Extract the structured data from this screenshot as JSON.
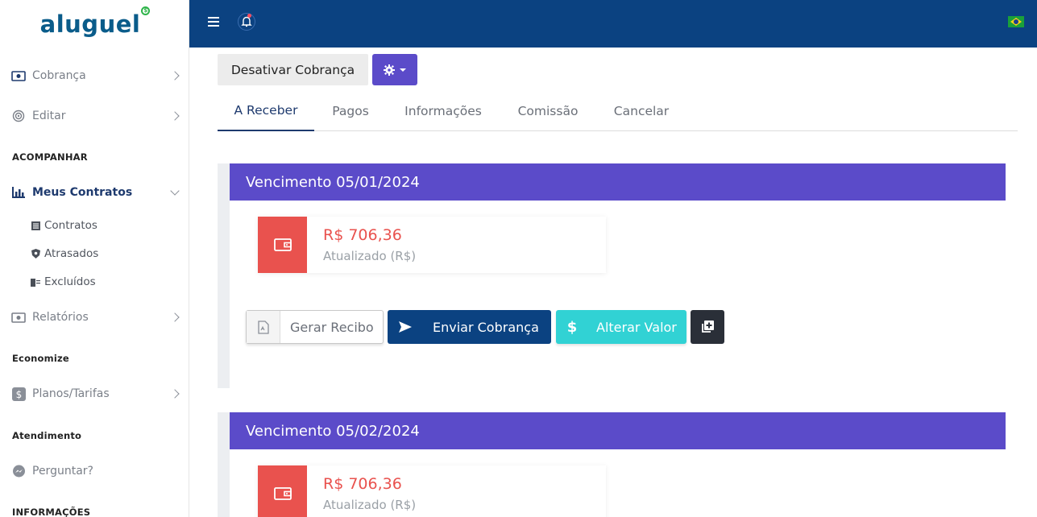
{
  "brand": {
    "name": "aluguel"
  },
  "sidebar": {
    "items": [
      {
        "label": "Cobrança",
        "icon": "money-icon"
      },
      {
        "label": "Editar",
        "icon": "target-icon"
      },
      {
        "label": "Meus Contratos",
        "icon": "bar-chart-icon"
      },
      {
        "label": "Relatórios",
        "icon": "money-icon"
      },
      {
        "label": "Planos/Tarifas",
        "icon": "dollar-icon"
      },
      {
        "label": "Perguntar?",
        "icon": "messenger-icon"
      }
    ],
    "sections": [
      "ACOMPANHAR",
      "Economize",
      "Atendimento",
      "INFORMAÇÕES"
    ],
    "subitems": [
      {
        "label": "Contratos",
        "icon": "list-icon"
      },
      {
        "label": "Atrasados",
        "icon": "shield-icon"
      },
      {
        "label": "Excluídos",
        "icon": "trash-icon"
      }
    ]
  },
  "topbar": {
    "notification_dot_color": "#ff4d5e"
  },
  "toolbar": {
    "deactivate_label": "Desativar Cobrança"
  },
  "tabs": [
    {
      "label": "A Receber",
      "active": true
    },
    {
      "label": "Pagos"
    },
    {
      "label": "Informações"
    },
    {
      "label": "Comissão"
    },
    {
      "label": "Cancelar"
    }
  ],
  "cards": [
    {
      "title": "Vencimento 05/01/2024",
      "amount": "R$ 706,36",
      "amount_label": "Atualizado (R$)"
    },
    {
      "title": "Vencimento 05/02/2024",
      "amount": "R$ 706,36",
      "amount_label": "Atualizado (R$)"
    }
  ],
  "actions": {
    "receipt": "Gerar Recibo",
    "send": "Enviar Cobrança",
    "change_value": "Alterar Valor"
  },
  "colors": {
    "primary": "#0b4281",
    "accent": "#5b4bc9",
    "danger": "#e9524e",
    "teal": "#31d2d4"
  }
}
